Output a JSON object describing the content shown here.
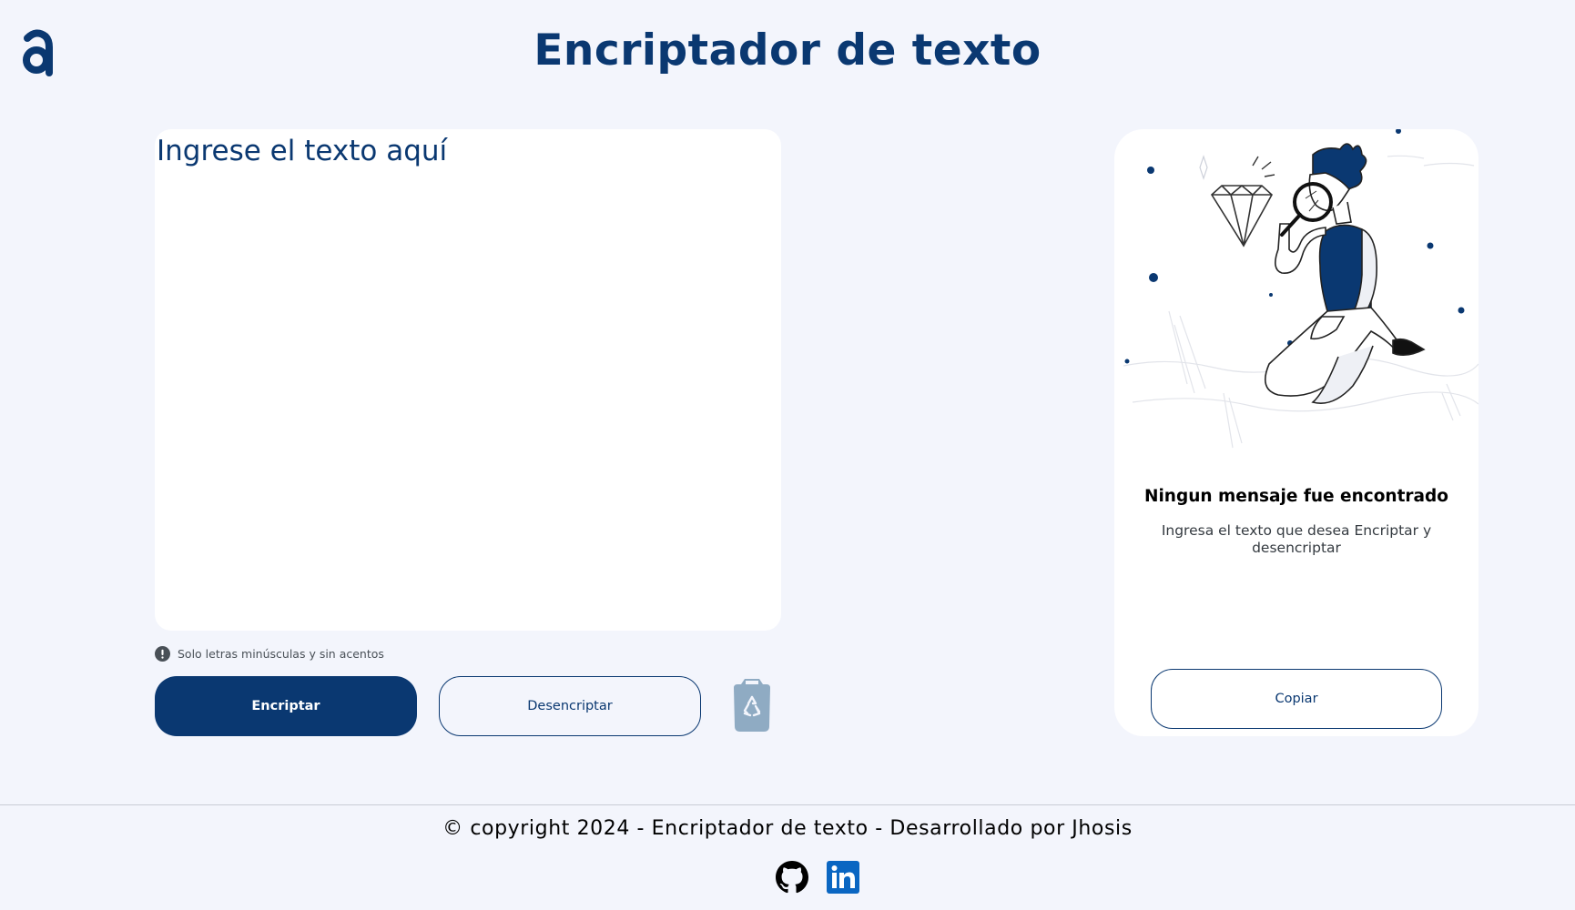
{
  "header": {
    "title": "Encriptador de texto",
    "logo_icon": "alura-logo-icon"
  },
  "input": {
    "placeholder": "Ingrese el texto aquí",
    "value": ""
  },
  "hint": {
    "icon": "exclamation-circle-icon",
    "text": "Solo letras minúsculas y sin acentos"
  },
  "actions": {
    "encrypt_label": "Encriptar",
    "decrypt_label": "Desencriptar",
    "clear_icon": "recycle-bin-icon"
  },
  "output": {
    "illustration": "person-with-magnifier-illustration",
    "title": "Ningun mensaje fue encontrado",
    "text": "Ingresa el texto que desea Encriptar y desencriptar",
    "copy_label": "Copiar"
  },
  "footer": {
    "copyright": "© copyright 2024 - Encriptador de texto - Desarrollado por Jhosis",
    "links": [
      "github-icon",
      "linkedin-icon"
    ]
  },
  "colors": {
    "primary": "#0a3871",
    "background": "#f3f5fc",
    "panel": "#ffffff",
    "trash": "#8fabc3",
    "linkedin": "#0a66c2"
  }
}
